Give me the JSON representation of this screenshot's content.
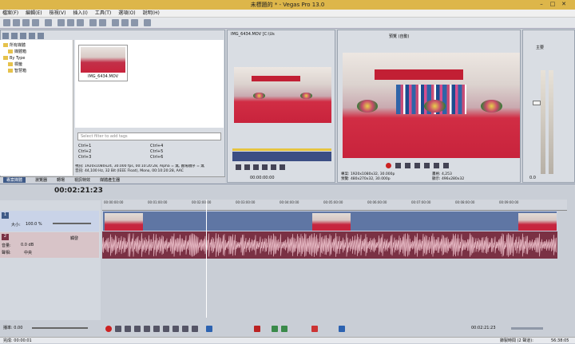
{
  "app": {
    "title": "未標題的 * - Vegas Pro 13.0",
    "window_controls": [
      "–",
      "□",
      "✕"
    ]
  },
  "menu": [
    "檔案(F)",
    "編輯(E)",
    "檢視(V)",
    "插入(I)",
    "工具(T)",
    "選項(O)",
    "說明(H)"
  ],
  "explorer": {
    "tree": [
      "所有媒體",
      "媒體箱",
      "By Type",
      "標籤",
      "智慧箱"
    ],
    "file": "IMG_6434.MOV",
    "search_placeholder": "Select filter to add tags",
    "shortcuts_left": [
      "Ctrl+1",
      "Ctrl+2",
      "Ctrl+3"
    ],
    "shortcuts_right": [
      "Ctrl+4",
      "Ctrl+5",
      "Ctrl+6"
    ],
    "info_line1": "視訊: 1920x1080x24, 30.000 fps, 00:10:20:28, Alpha = 無, 圖場順序 = 無",
    "info_line2": "音訊: 44,100 Hz, 32 Bit (IEEE Float), Mono, 00:10:20:28, AAC",
    "tabs": [
      "專案媒體",
      "瀏覽器",
      "轉場",
      "視訊特效",
      "媒體產生器"
    ]
  },
  "trimmer": {
    "file": "IMG_6434.MOV",
    "drive": "[C:\\Us",
    "timecode": "00:00:00:00"
  },
  "preview": {
    "quality": "預覽 (自動)",
    "project_line": "專案: 1920x1080x32, 30.000p",
    "preview_line": "預覽: 480x270x32, 30.000p",
    "frame_label": "畫格: 4,253",
    "display_label": "顯示: 496x280x32"
  },
  "mixer": {
    "label": "主要",
    "value": "0.0"
  },
  "timeline": {
    "timecode": "00:02:21:23",
    "ruler": [
      "00:00:00:00",
      "00:01:00:00",
      "00:02:00:00",
      "00:03:00:00",
      "00:04:00:00",
      "00:05:00:00",
      "00:06:00:00",
      "00:07:00:00",
      "00:08:00:00",
      "00:09:00:00"
    ],
    "video_track": {
      "num": "1",
      "level_label": "大小:",
      "level_value": "100.0 %"
    },
    "audio_track": {
      "num": "2",
      "vol_label": "音量:",
      "vol_value": "0.0 dB",
      "pan_label": "聲相:",
      "pan_value": "中央",
      "mode": "觸發"
    }
  },
  "transport": {
    "rate_label": "播率: 0.00",
    "timecode": "00:02:21:23"
  },
  "status": {
    "left": "完成: 00:00:01",
    "right_label": "錄製時間 (2 聲道):",
    "right_value": "56:38:05"
  }
}
